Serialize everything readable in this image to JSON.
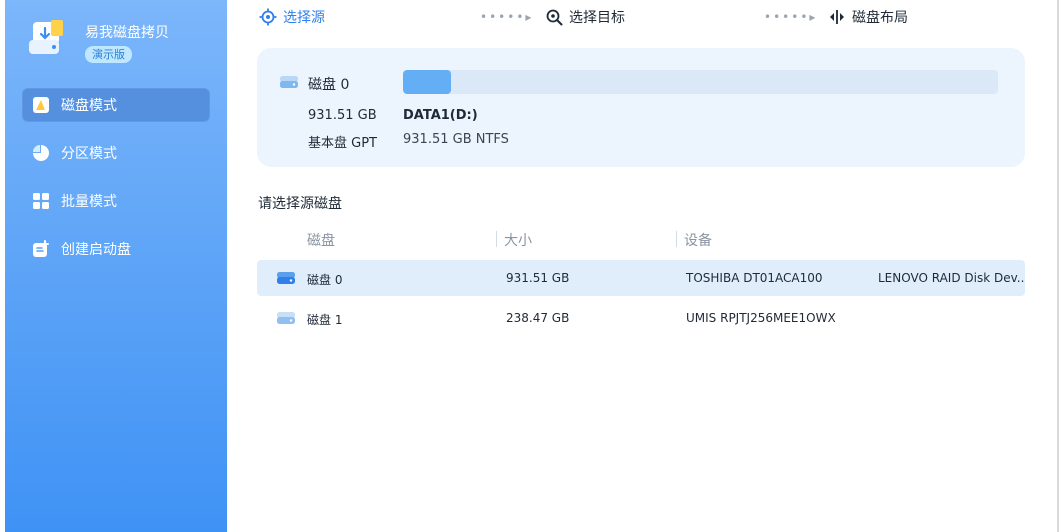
{
  "app": {
    "name": "易我磁盘拷贝",
    "edition": "演示版"
  },
  "sidebar": {
    "items": [
      {
        "label": "磁盘模式",
        "active": true
      },
      {
        "label": "分区模式",
        "active": false
      },
      {
        "label": "批量模式",
        "active": false
      },
      {
        "label": "创建启动盘",
        "active": false
      }
    ]
  },
  "steps": [
    {
      "label": "选择源",
      "active": true
    },
    {
      "label": "选择目标",
      "active": false
    },
    {
      "label": "磁盘布局",
      "active": false
    }
  ],
  "step_separator": "•••••▸",
  "source": {
    "disk_name": "磁盘 0",
    "size": "931.51 GB",
    "type": "基本盘 GPT",
    "partition_label": "DATA1(D:)",
    "partition_info": "931.51 GB NTFS",
    "partition_used_fraction": 0.08
  },
  "section_title": "请选择源磁盘",
  "table": {
    "headers": [
      "磁盘",
      "大小",
      "设备"
    ],
    "rows": [
      {
        "name": "磁盘 0",
        "size": "931.51 GB",
        "device": "TOSHIBA DT01ACA100",
        "extra": "LENOVO RAID Disk Dev...",
        "selected": true
      },
      {
        "name": "磁盘 1",
        "size": "238.47 GB",
        "device": "UMIS RPJTJ256MEE1OWX",
        "extra": "",
        "selected": false
      }
    ]
  },
  "colors": {
    "accent": "#2f80ed",
    "sidebar_top": "#7cb6fb",
    "sidebar_bottom": "#3f92f5",
    "card_bg": "#ecf4fd",
    "selected_row": "#e0eefc"
  }
}
